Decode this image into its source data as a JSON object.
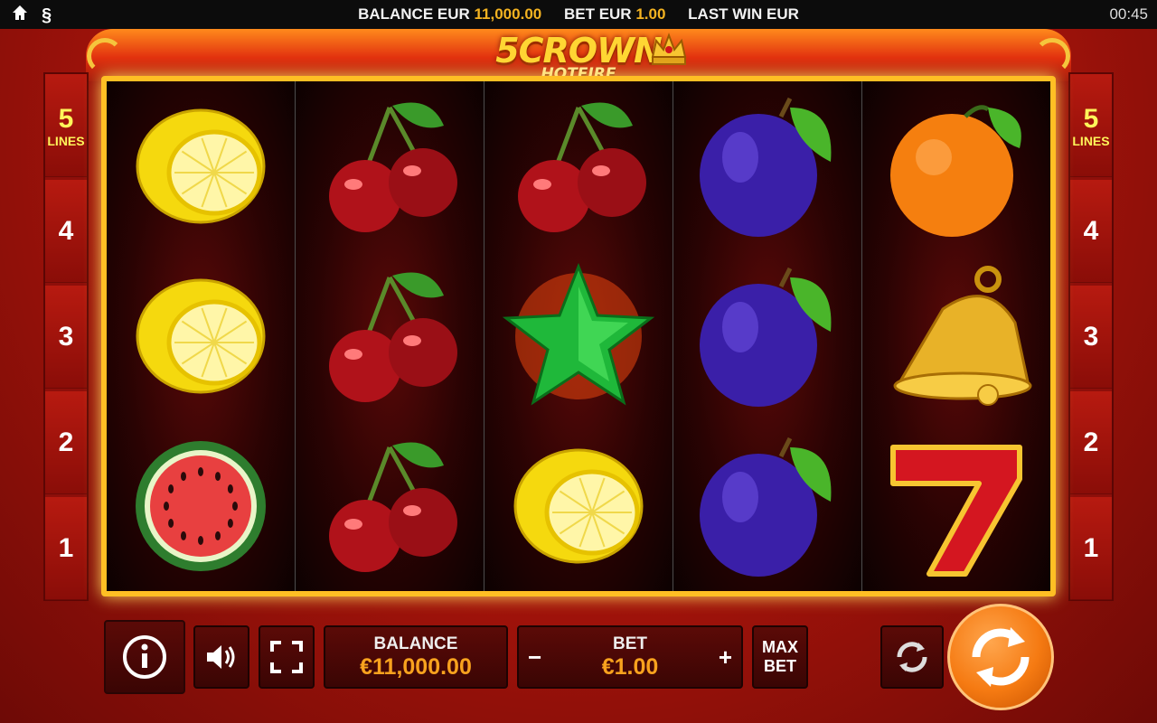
{
  "topbar": {
    "balance_label": "BALANCE EUR",
    "balance_value": "11,000.00",
    "bet_label": "BET EUR",
    "bet_value": "1.00",
    "last_win_label": "LAST WIN EUR",
    "clock": "00:45"
  },
  "logo": {
    "title": "5CROWN",
    "subtitle": "HOTFIRE"
  },
  "lines": {
    "left": [
      {
        "number": "5",
        "word": "LINES"
      },
      {
        "number": "4"
      },
      {
        "number": "3"
      },
      {
        "number": "2"
      },
      {
        "number": "1"
      }
    ],
    "right": [
      {
        "number": "5",
        "word": "LINES"
      },
      {
        "number": "4"
      },
      {
        "number": "3"
      },
      {
        "number": "2"
      },
      {
        "number": "1"
      }
    ]
  },
  "reels": [
    [
      "lemon",
      "lemon",
      "watermelon"
    ],
    [
      "cherry",
      "cherry",
      "cherry"
    ],
    [
      "cherry",
      "star",
      "lemon"
    ],
    [
      "plum",
      "plum",
      "plum"
    ],
    [
      "orange",
      "bell",
      "seven"
    ]
  ],
  "controls": {
    "info_icon": "info-icon",
    "sound_icon": "speaker-icon",
    "fullscreen_icon": "fullscreen-icon",
    "balance_label": "BALANCE",
    "balance_value": "€11,000.00",
    "bet_label": "BET",
    "bet_value": "€1.00",
    "bet_minus": "−",
    "bet_plus": "+",
    "maxbet_line1": "MAX",
    "maxbet_line2": "BET",
    "autoplay_icon": "autoplay-icon",
    "spin_icon": "spin-icon"
  },
  "colors": {
    "accent_gold": "#ffbf24",
    "value_orange": "#f8a21e",
    "spin_orange": "#f57a12",
    "background_red": "#b3160c"
  }
}
